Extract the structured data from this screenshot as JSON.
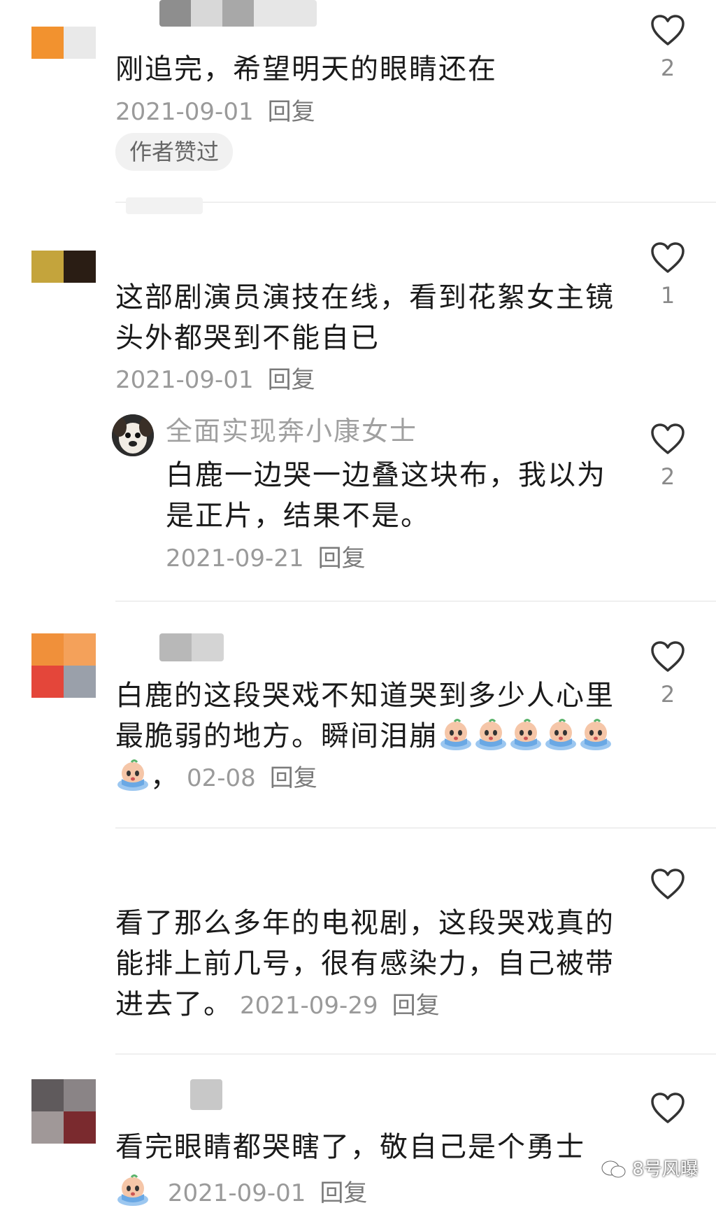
{
  "comments": [
    {
      "text": "刚追完，希望明天的眼睛还在",
      "date": "2021-09-01",
      "reply_label": "回复",
      "likes": "2",
      "tag": "作者赞过"
    },
    {
      "text": "这部剧演员演技在线，看到花絮女主镜头外都哭到不能自已",
      "date": "2021-09-01",
      "reply_label": "回复",
      "likes": "1",
      "sub_reply": {
        "username": "全面实现奔小康女士",
        "text": "白鹿一边哭一边叠这块布，我以为是正片，结果不是。",
        "date": "2021-09-21",
        "reply_label": "回复",
        "likes": "2"
      }
    },
    {
      "text": "白鹿的这段哭戏不知道哭到多少人心里最脆弱的地方。瞬间泪崩",
      "text_suffix": "，",
      "date": "02-08",
      "reply_label": "回复",
      "likes": "2",
      "emoji": "crying-emoji"
    },
    {
      "text": "看了那么多年的电视剧，这段哭戏真的能排上前几号，很有感染力，自己被带进去了。",
      "date": "2021-09-29",
      "reply_label": "回复",
      "likes": ""
    },
    {
      "text": "看完眼睛都哭瞎了，敬自己是个勇士",
      "date": "2021-09-01",
      "reply_label": "回复",
      "likes": ""
    }
  ],
  "watermark": "8号风曝",
  "icons": {
    "like": "heart-outline-icon",
    "emoji": "crying-face-emoji",
    "watermark": "wechat-icon"
  },
  "colors": {
    "text": "#1a1a1a",
    "meta": "#9a9a9a",
    "divider": "#efefef",
    "tag_bg": "#f1f1f1"
  }
}
